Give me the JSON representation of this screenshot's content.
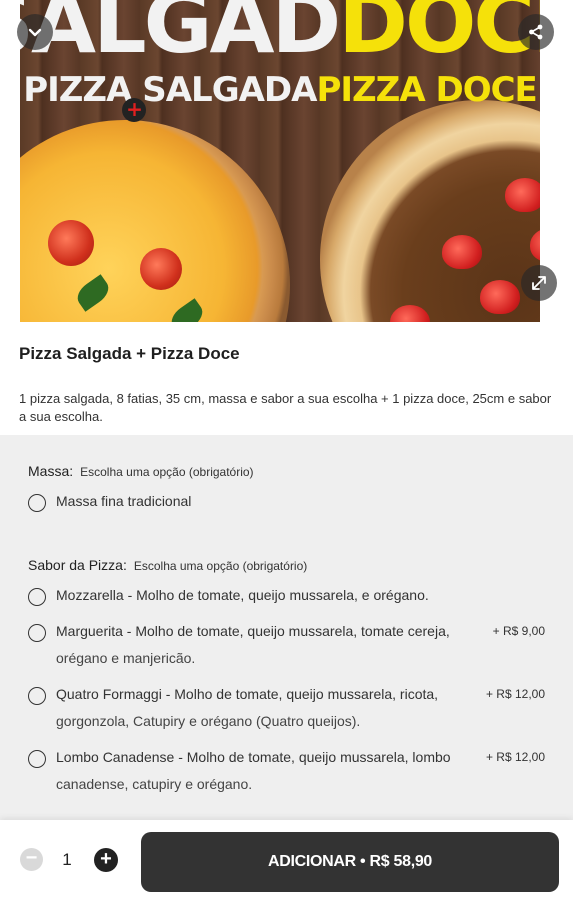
{
  "hero": {
    "title_part1": "SALGAD",
    "title_part2": "DOCE",
    "subtitle_part1": "PIZZA SALGADA",
    "subtitle_plus": "+",
    "subtitle_part2": "PIZZA DOCE"
  },
  "icons": {
    "back": "chevron-down-icon",
    "share": "share-icon",
    "expand": "expand-icon"
  },
  "product": {
    "name": "Pizza Salgada + Pizza Doce",
    "description": "1 pizza salgada, 8 fatias, 35 cm, massa e sabor a sua escolha + 1 pizza doce, 25cm e sabor a sua escolha."
  },
  "groups": {
    "massa": {
      "title": "Massa:",
      "requirement": "Escolha uma opção (obrigatório)",
      "options": [
        {
          "label": "Massa fina tradicional",
          "price": ""
        }
      ]
    },
    "sabor": {
      "title": "Sabor da Pizza:",
      "requirement": "Escolha uma opção (obrigatório)",
      "options": [
        {
          "line1": "Mozzarella - Molho de tomate, queijo mussarela, e orégano.",
          "line2": "",
          "price": ""
        },
        {
          "line1": "Marguerita - Molho de tomate, queijo mussarela, tomate cereja,",
          "line2": "orégano e manjericão.",
          "price": "+ R$ 9,00"
        },
        {
          "line1": "Quatro Formaggi - Molho de tomate, queijo mussarela, ricota,",
          "line2": "gorgonzola, Catupiry e orégano (Quatro queijos).",
          "price": "+ R$ 12,00"
        },
        {
          "line1": "Lombo Canadense - Molho de tomate, queijo mussarela, lombo",
          "line2": "canadense, catupiry e orégano.",
          "price": "+ R$ 12,00"
        }
      ]
    }
  },
  "footer": {
    "minus": "−",
    "quantity": "1",
    "plus": "+",
    "add_label": "ADICIONAR • R$ 58,90"
  },
  "colors": {
    "accent_yellow": "#f5e10a",
    "button_dark": "#333333",
    "options_bg": "#efefef"
  }
}
